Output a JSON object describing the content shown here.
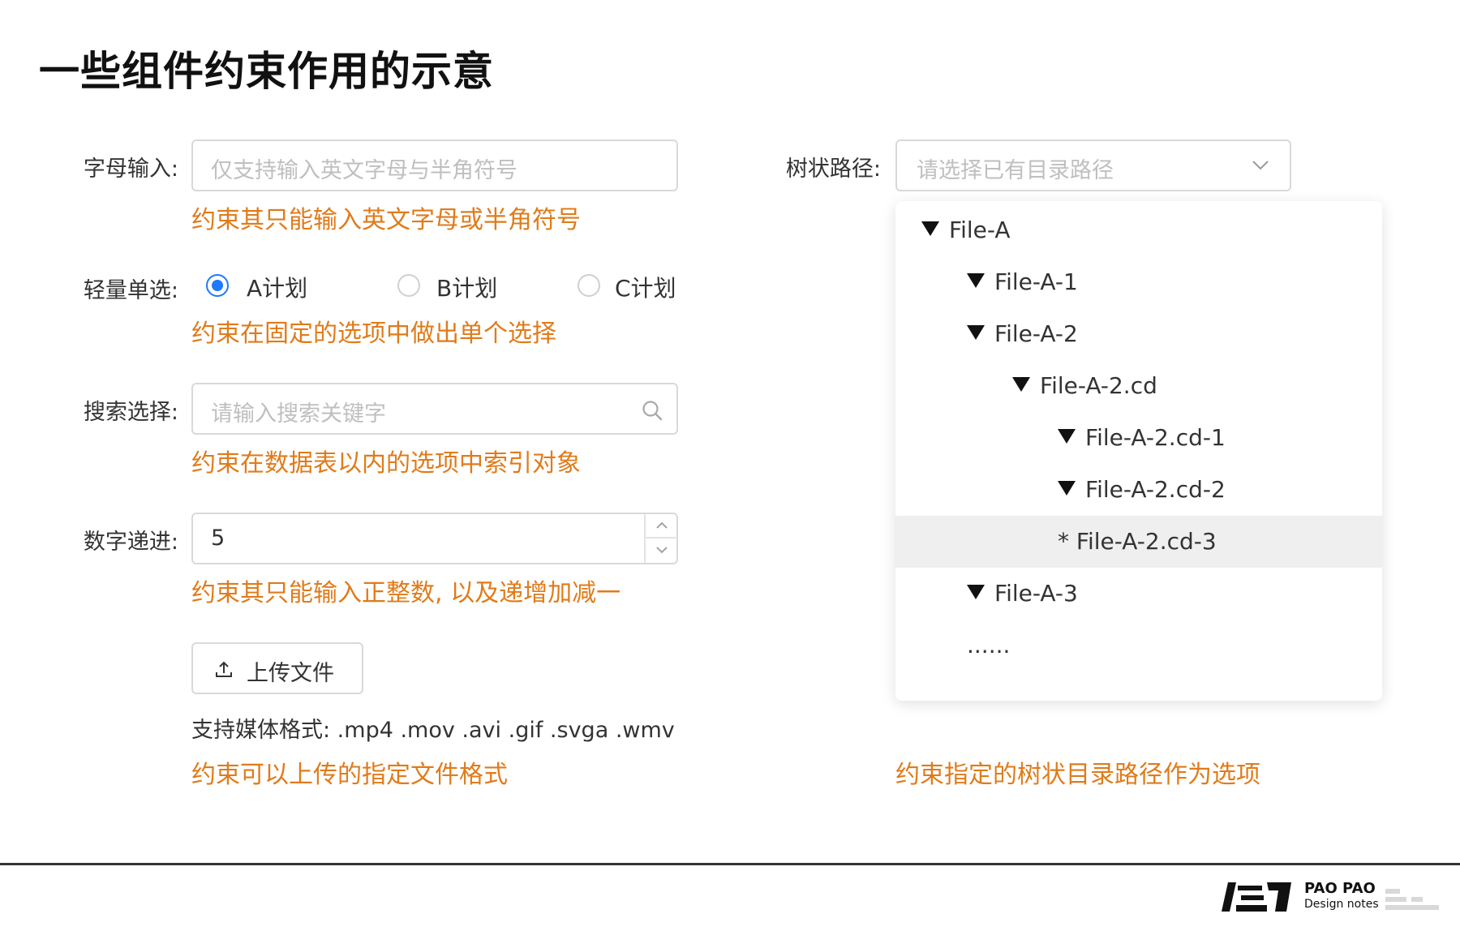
{
  "page": {
    "title": "一些组件约束作用的示意"
  },
  "letters": {
    "label": "字母输入:",
    "placeholder": "仅支持输入英文字母与半角符号",
    "note": "约束其只能输入英文字母或半角符号"
  },
  "radio": {
    "label": "轻量单选:",
    "options": [
      {
        "label": "A计划",
        "checked": true
      },
      {
        "label": "B计划",
        "checked": false
      },
      {
        "label": "C计划",
        "checked": false
      }
    ],
    "note": "约束在固定的选项中做出单个选择"
  },
  "search": {
    "label": "搜索选择:",
    "placeholder": "请输入搜索关键字",
    "icon": "search-icon",
    "note": "约束在数据表以内的选项中索引对象"
  },
  "number": {
    "label": "数字递进:",
    "value": "5",
    "note": "约束其只能输入正整数, 以及递增加减一"
  },
  "upload": {
    "button_label": "上传文件",
    "icon": "upload-icon",
    "formats": "支持媒体格式: .mp4 .mov .avi .gif .svga .wmv",
    "note": "约束可以上传的指定文件格式"
  },
  "tree_path": {
    "label": "树状路径:",
    "placeholder": "请选择已有目录路径",
    "icon": "chevron-down-icon",
    "items": [
      {
        "text": "File-A",
        "level": 0,
        "marker": "triangle"
      },
      {
        "text": "File-A-1",
        "level": 1,
        "marker": "triangle"
      },
      {
        "text": "File-A-2",
        "level": 1,
        "marker": "triangle"
      },
      {
        "text": "File-A-2.cd",
        "level": 2,
        "marker": "triangle"
      },
      {
        "text": "File-A-2.cd-1",
        "level": 3,
        "marker": "triangle"
      },
      {
        "text": "File-A-2.cd-2",
        "level": 3,
        "marker": "triangle"
      },
      {
        "text": "* File-A-2.cd-3",
        "level": 3,
        "marker": "none",
        "selected": true
      },
      {
        "text": "File-A-3",
        "level": 1,
        "marker": "triangle"
      },
      {
        "text": "......",
        "level": 1,
        "marker": "none"
      }
    ],
    "note": "约束指定的树状目录路径作为选项"
  },
  "footer": {
    "brand_top": "PAO PAO",
    "brand_bottom": "Design notes"
  },
  "colors": {
    "accent": "#1f78ff",
    "note": "#e07b1a",
    "border": "#d9d9d9"
  }
}
